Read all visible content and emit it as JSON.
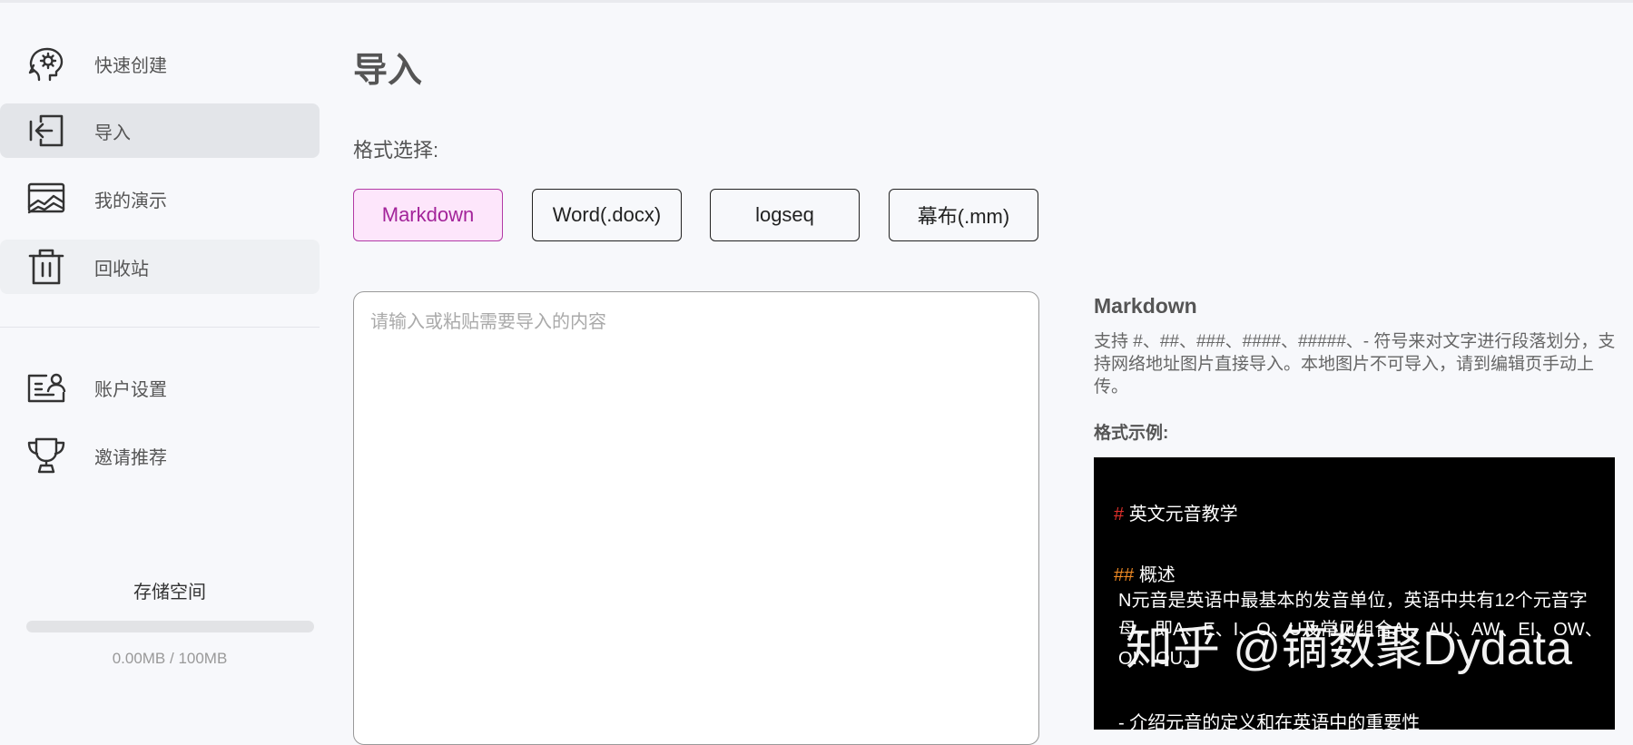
{
  "sidebar": {
    "items": [
      {
        "label": "快速创建",
        "icon": "brain-icon"
      },
      {
        "label": "导入",
        "icon": "import-icon"
      },
      {
        "label": "我的演示",
        "icon": "presentation-icon"
      },
      {
        "label": "回收站",
        "icon": "trash-icon"
      },
      {
        "label": "账户设置",
        "icon": "account-icon"
      },
      {
        "label": "邀请推荐",
        "icon": "trophy-icon"
      }
    ],
    "storage": {
      "title": "存储空间",
      "usage": "0.00MB / 100MB",
      "used_fraction": 0.0
    }
  },
  "main": {
    "title": "导入",
    "format_label": "格式选择:",
    "formats": [
      "Markdown",
      "Word(.docx)",
      "logseq",
      "幕布(.mm)"
    ],
    "selected_format": "Markdown",
    "editor": {
      "placeholder": "请输入或粘贴需要导入的内容",
      "value": ""
    }
  },
  "help": {
    "title": "Markdown",
    "description": "支持 #、##、###、####、#####、- 符号来对文字进行段落划分，支持网络地址图片直接导入。本地图片不可导入，请到编辑页手动上传。",
    "example_label": "格式示例:",
    "example": {
      "h1_marker": "#",
      "h1_text": "英文元音教学",
      "h2_marker": "##",
      "h2_text": "概述",
      "paragraph": "N元音是英语中最基本的发音单位，英语中共有12个元音字母，即A、E、I、O、U及常见组合AI、AU、AW、EI、OW、OI、OU。",
      "next_line": "- 介绍元音的定义和在英语中的重要性"
    }
  },
  "watermark": "知乎 @镝数聚Dydata",
  "colors": {
    "selected_bg": "#fde6fb",
    "selected_border": "#b23aa5",
    "selected_text": "#a3249a",
    "h1_marker": "#e0302b",
    "h2_marker": "#f08a24"
  }
}
